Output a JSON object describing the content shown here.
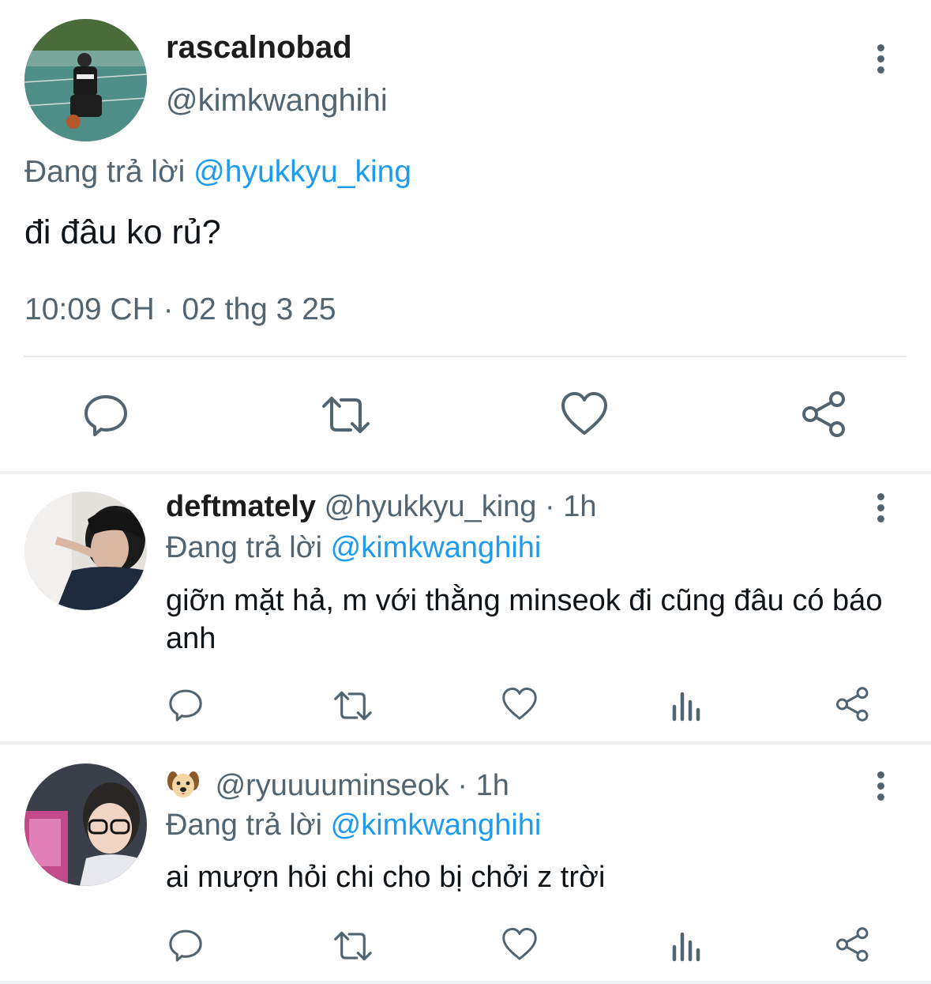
{
  "main_tweet": {
    "display_name": "rascalnobad",
    "handle": "@kimkwanghihi",
    "replying_prefix": "Đang trả lời",
    "replying_to": "@hyukkyu_king",
    "text": "đi đâu ko rủ?",
    "timestamp": "10:09 CH · 02 thg 3 25",
    "actions": [
      "reply-icon",
      "retweet-icon",
      "like-icon",
      "share-icon"
    ]
  },
  "replies": [
    {
      "display_name": "deftmately",
      "handle": "@hyukkyu_king",
      "separator": "·",
      "time": "1h",
      "replying_prefix": "Đang trả lời",
      "replying_to": "@kimkwanghihi",
      "text": "giỡn mặt hả, m với thằng minseok đi cũng đâu có báo anh",
      "actions": [
        "reply-icon",
        "retweet-icon",
        "like-icon",
        "views-icon",
        "share-icon"
      ]
    },
    {
      "display_name_icon": "dog-face-emoji",
      "handle": "@ryuuuuminseok",
      "separator": "·",
      "time": "1h",
      "replying_prefix": "Đang trả lời",
      "replying_to": "@kimkwanghihi",
      "text": "ai mượn hỏi chi cho bị chởi z trời",
      "actions": [
        "reply-icon",
        "retweet-icon",
        "like-icon",
        "views-icon",
        "share-icon"
      ]
    }
  ],
  "colors": {
    "link": "#1d9bf0",
    "secondary_text": "#536471",
    "primary_text": "#0f1419",
    "divider": "#e7e9ea"
  }
}
